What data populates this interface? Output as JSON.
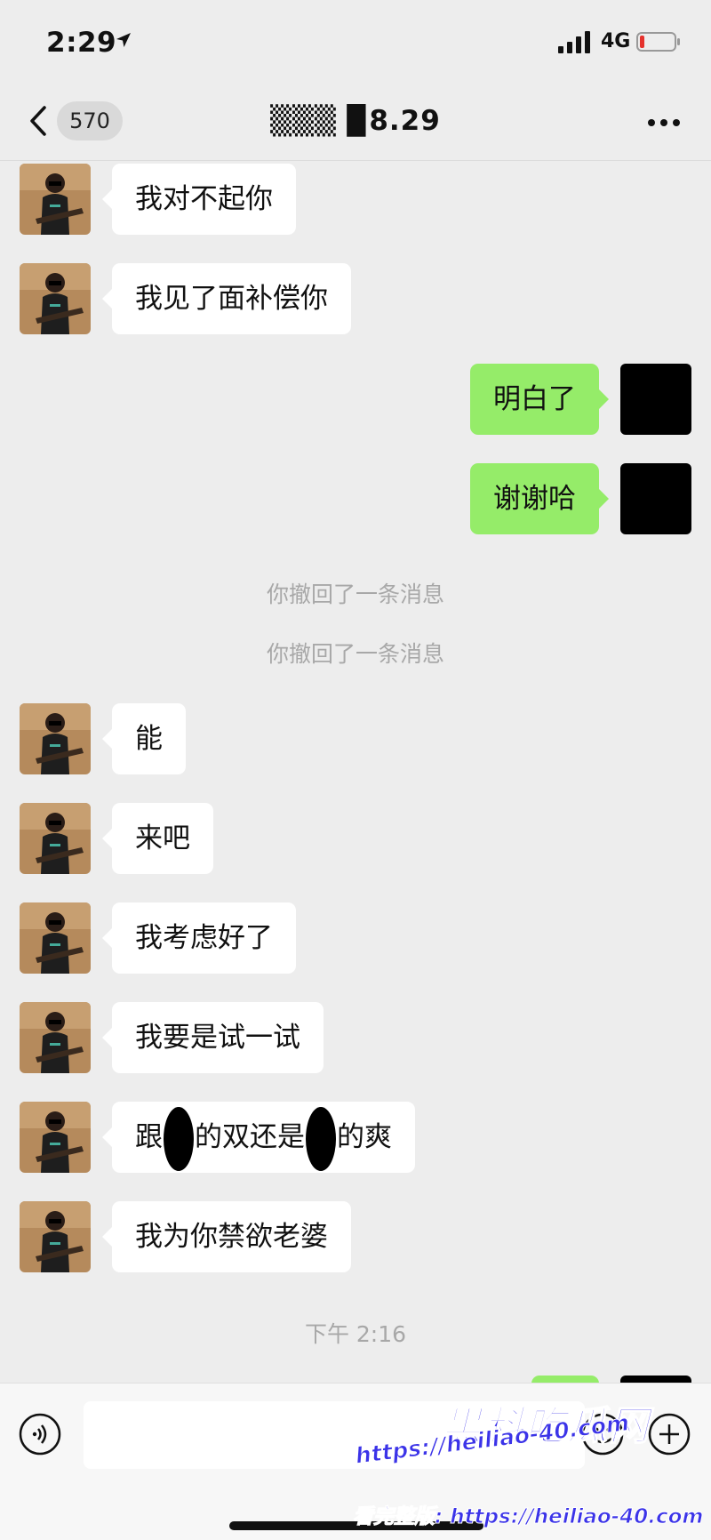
{
  "status_bar": {
    "time": "2:29",
    "network": "4G"
  },
  "nav": {
    "unread_count": "570",
    "title": "▒▒▒ ▉8.29"
  },
  "messages": [
    {
      "side": "in",
      "text": "我对不起你"
    },
    {
      "side": "in",
      "text": "我见了面补偿你"
    },
    {
      "side": "out",
      "text": "明白了"
    },
    {
      "side": "out",
      "text": "谢谢哈"
    },
    {
      "type": "system",
      "text": "你撤回了一条消息"
    },
    {
      "type": "system",
      "text": "你撤回了一条消息"
    },
    {
      "side": "in",
      "text": "能"
    },
    {
      "side": "in",
      "text": "来吧"
    },
    {
      "side": "in",
      "text": "我考虑好了"
    },
    {
      "side": "in",
      "text": "我要是试一试"
    },
    {
      "side": "in",
      "text_parts": [
        "跟",
        "的双还是",
        "的爽"
      ]
    },
    {
      "side": "in",
      "text": "我为你禁欲老婆"
    },
    {
      "type": "time",
      "text": "下午 2:16"
    }
  ],
  "input": {
    "placeholder": ""
  },
  "watermark": {
    "logo": "黑料吃瓜网",
    "url": "https://heiliao-40.com",
    "sub": "看完整版: https://heiliao-40.com"
  }
}
